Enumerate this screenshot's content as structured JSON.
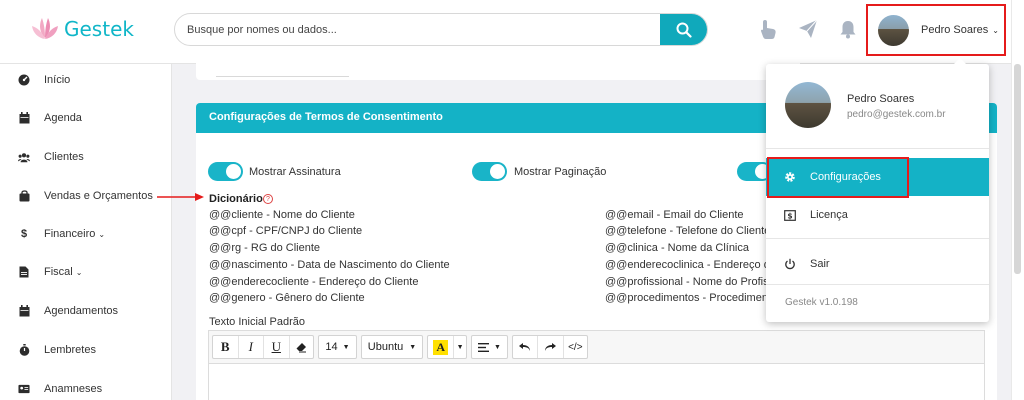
{
  "brand": {
    "name": "Gestek",
    "color": "#10b6c8"
  },
  "search": {
    "placeholder": "Busque por nomes ou dados..."
  },
  "header_icons": [
    "touch-icon",
    "paper-plane-icon",
    "bell-icon"
  ],
  "user": {
    "name": "Pedro Soares",
    "email": "pedro@gestek.com.br"
  },
  "sidebar": {
    "items": [
      {
        "label": "Início",
        "icon": "dashboard-icon"
      },
      {
        "label": "Agenda",
        "icon": "calendar-icon"
      },
      {
        "label": "Clientes",
        "icon": "users-icon"
      },
      {
        "label": "Vendas e Orçamentos",
        "icon": "bag-icon"
      },
      {
        "label": "Financeiro",
        "icon": "dollar-icon",
        "caret": "⌄"
      },
      {
        "label": "Fiscal",
        "icon": "document-icon",
        "caret": "⌄"
      },
      {
        "label": "Agendamentos",
        "icon": "calendar-icon"
      },
      {
        "label": "Lembretes",
        "icon": "stopwatch-icon"
      },
      {
        "label": "Anamneses",
        "icon": "id-card-icon"
      }
    ]
  },
  "card": {
    "title": "Configurações de Termos de Consentimento",
    "toggles": [
      {
        "label": "Mostrar Assinatura",
        "on": true
      },
      {
        "label": "Mostrar Paginação",
        "on": true
      },
      {
        "label": "",
        "on": true
      }
    ],
    "dictionary_label": "Dicionário",
    "dictionary_left": [
      {
        "token": "@@cliente",
        "desc": " - Nome do Cliente"
      },
      {
        "token": "@@cpf",
        "desc": " - CPF/CNPJ do Cliente"
      },
      {
        "token": "@@rg",
        "desc": " - RG do Cliente"
      },
      {
        "token": "@@nascimento",
        "desc": " - Data de Nascimento do Cliente"
      },
      {
        "token": "@@enderecocliente",
        "desc": " - Endereço do Cliente"
      },
      {
        "token": "@@genero",
        "desc": " - Gênero do Cliente"
      }
    ],
    "dictionary_right": [
      {
        "token": "@@email",
        "desc": " - Email do Cliente"
      },
      {
        "token": "@@telefone",
        "desc": " - Telefone do Cliente"
      },
      {
        "token": "@@clinica",
        "desc": " - Nome da Clínica"
      },
      {
        "token": "@@enderecoclinica",
        "desc": " - Endereço da"
      },
      {
        "token": "@@profissional",
        "desc": " - Nome do Profissi"
      },
      {
        "token": "@@procedimentos",
        "desc": " - Procedimento"
      }
    ],
    "editor_label": "Texto Inicial Padrão",
    "toolbar": {
      "bold": "B",
      "italic": "I",
      "underline": "U",
      "font_size": "14",
      "font_family": "Ubuntu",
      "color_label": "A",
      "code": "</>"
    }
  },
  "menu": {
    "items": [
      {
        "label": "Configurações",
        "icon": "gear-icon",
        "active": true
      },
      {
        "label": "Licença",
        "icon": "dollar-bill-icon",
        "active": false
      },
      {
        "label": "Sair",
        "icon": "power-icon",
        "active": false
      }
    ],
    "version": "Gestek v1.0.198"
  },
  "colors": {
    "accent": "#14b2c6",
    "highlight": "#e51b1b"
  }
}
